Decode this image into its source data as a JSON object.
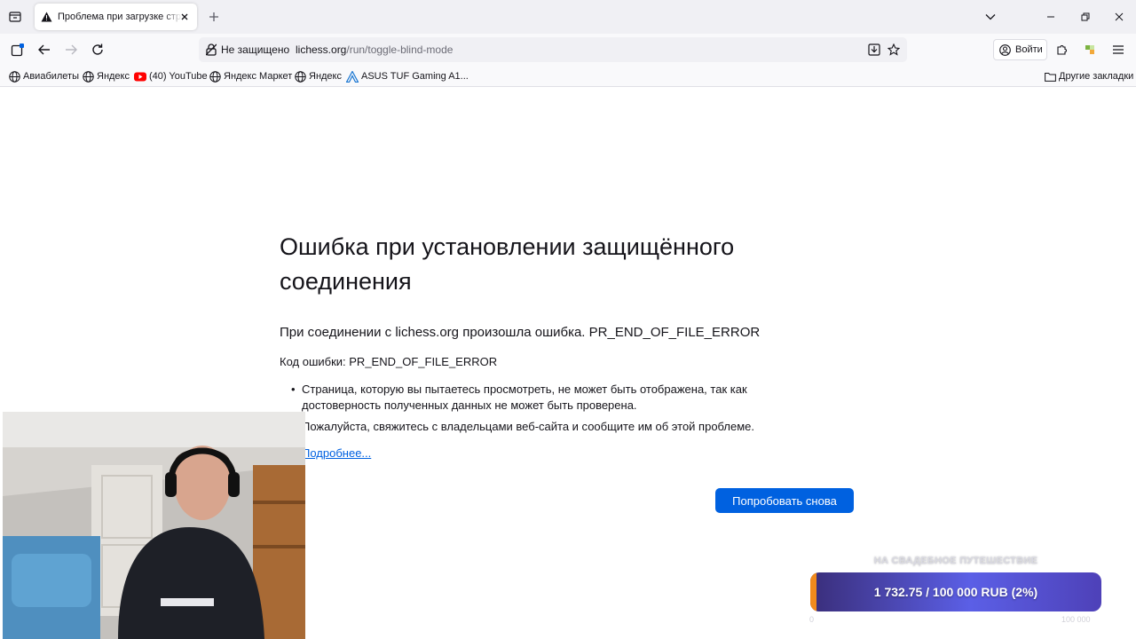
{
  "browser": {
    "tab": {
      "title": "Проблема при загрузке страницы",
      "icon": "warning-icon"
    },
    "window_controls": [
      "minimize-icon",
      "restore-icon",
      "close-icon"
    ],
    "url": {
      "security_label": "Не защищено",
      "host": "lichess.org",
      "path": "/run/toggle-blind-mode"
    },
    "login_label": "Войти",
    "bookmarks": [
      {
        "label": "Авиабилеты",
        "icon": "globe-icon"
      },
      {
        "label": "Яндекс",
        "icon": "globe-icon"
      },
      {
        "label": "(40) YouTube",
        "icon": "youtube-icon"
      },
      {
        "label": "Яндекс Маркет",
        "icon": "globe-icon"
      },
      {
        "label": "Яндекс",
        "icon": "globe-icon"
      },
      {
        "label": "ASUS TUF Gaming A1...",
        "icon": "asus-icon"
      }
    ],
    "other_bookmarks_label": "Другие закладки"
  },
  "error_page": {
    "title": "Ошибка при установлении защищённого соединения",
    "description": "При соединении с lichess.org произошла ошибка. PR_END_OF_FILE_ERROR",
    "code": "Код ошибки: PR_END_OF_FILE_ERROR",
    "bullets": [
      "Страница, которую вы пытаетесь просмотреть, не может быть отображена, так как достоверность полученных данных не может быть проверена.",
      "Пожалуйста, свяжитесь с владельцами веб-сайта и сообщите им об этой проблеме."
    ],
    "learn_more": "Подробнее...",
    "retry_label": "Попробовать снова"
  },
  "donation_goal": {
    "caption": "НА СВАДЕБНОЕ ПУТЕШЕСТВИЕ",
    "progress_text": "1 732.75 / 100 000 RUB (2%)",
    "progress_fraction": 0.02,
    "min_label": "0",
    "max_label": "100 000",
    "colors": {
      "fill": "#f08a1c",
      "bar": "#5b5fe6"
    }
  }
}
